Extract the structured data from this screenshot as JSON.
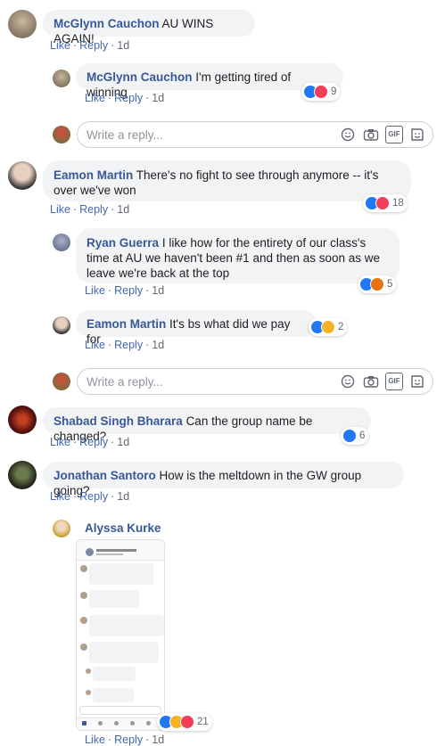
{
  "actions": {
    "like": "Like",
    "reply": "Reply",
    "time": "1d"
  },
  "reply_placeholder": "Write a reply...",
  "comments": [
    {
      "name": "McGlynn Cauchon",
      "text": "AU WINS AGAIN!"
    },
    {
      "name": "McGlynn Cauchon",
      "text": "I'm getting tired of winning",
      "reactions": "9"
    },
    {
      "name": "Eamon Martin",
      "text": "There's no fight to see through anymore -- it's over we've won",
      "reactions": "18"
    },
    {
      "name": "Ryan Guerra",
      "text": "I like how for the entirety of our class's time at AU we haven't been #1 and then as soon as we leave we're back at the top",
      "reactions": "5"
    },
    {
      "name": "Eamon Martin",
      "text": "It's bs what did we pay for",
      "reactions": "2"
    },
    {
      "name": "Shabad Singh Bharara",
      "text": "Can the group name be changed?",
      "reactions": "6"
    },
    {
      "name": "Jonathan Santoro",
      "text": "How is the meltdown in the GW group going?"
    },
    {
      "name": "Alyssa Kurke",
      "reactions": "21"
    }
  ],
  "icons": [
    "emoji-icon",
    "camera-icon",
    "gif-icon",
    "sticker-icon"
  ],
  "colors": {
    "link": "#385898",
    "like": "#2078f4",
    "love": "#f33e58",
    "haha": "#f7b125",
    "angry": "#e9710f"
  }
}
